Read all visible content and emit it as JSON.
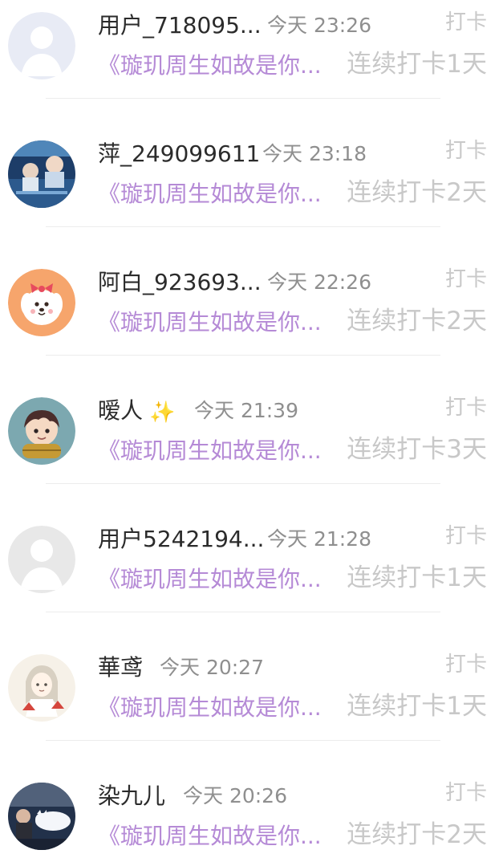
{
  "feed": {
    "items": [
      {
        "name": "用户_718095...",
        "time": "今天 23:26",
        "type": "打卡",
        "book": "《璇玑周生如故是你...",
        "streak": "连续打卡1天",
        "avatar": "avatar-default-icon",
        "sparkle": ""
      },
      {
        "name": "萍_249099611",
        "time": "今天 23:18",
        "type": "打卡",
        "book": "《璇玑周生如故是你...",
        "streak": "连续打卡2天",
        "avatar": "avatar-photo-icon",
        "sparkle": ""
      },
      {
        "name": "阿白_923693...",
        "time": "今天 22:26",
        "type": "打卡",
        "book": "《璇玑周生如故是你...",
        "streak": "连续打卡2天",
        "avatar": "avatar-cartoon-dog-icon",
        "sparkle": ""
      },
      {
        "name": "暧人",
        "time": "今天 21:39",
        "type": "打卡",
        "book": "《璇玑周生如故是你...",
        "streak": "连续打卡3天",
        "avatar": "avatar-cartoon-girl-icon",
        "sparkle": "✨"
      },
      {
        "name": "用户5242194...",
        "time": "今天 21:28",
        "type": "打卡",
        "book": "《璇玑周生如故是你...",
        "streak": "连续打卡1天",
        "avatar": "avatar-default-grey-icon",
        "sparkle": ""
      },
      {
        "name": "華鸢",
        "time": "今天 20:27",
        "type": "打卡",
        "book": "《璇玑周生如故是你...",
        "streak": "连续打卡1天",
        "avatar": "avatar-anime-icon",
        "sparkle": ""
      },
      {
        "name": "染九儿",
        "time": "今天 20:26",
        "type": "打卡",
        "book": "《璇玑周生如故是你...",
        "streak": "连续打卡2天",
        "avatar": "avatar-photo-cat-icon",
        "sparkle": ""
      }
    ]
  },
  "colors": {
    "book": "#b58ad6",
    "name": "#2b2b2b",
    "time": "#8f8f8f",
    "muted": "#c9c9c9"
  }
}
